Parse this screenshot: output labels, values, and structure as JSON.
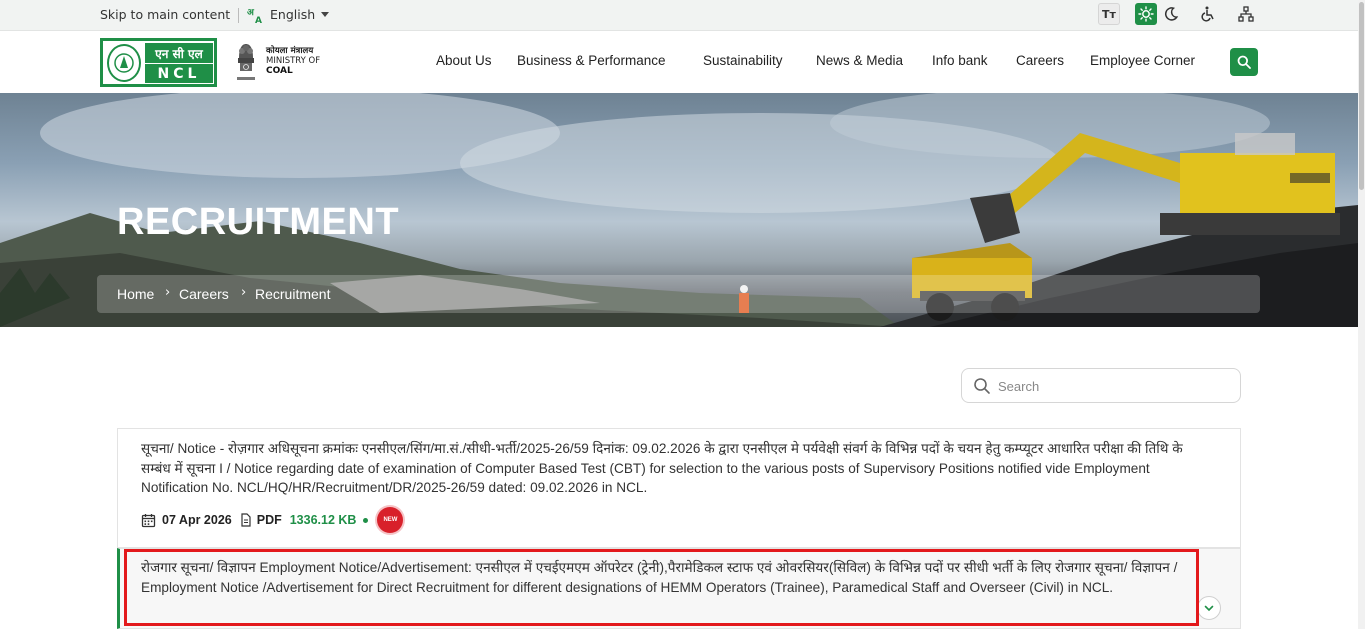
{
  "topbar": {
    "skip_link": "Skip to main content",
    "language": "English",
    "text_size_label": "Tт"
  },
  "header": {
    "logo_hindi": "एन सी एल",
    "logo_english": "NCL",
    "ministry_hindi": "कोयला मंत्रालय",
    "ministry_line1": "MINISTRY OF",
    "ministry_line2": "COAL"
  },
  "nav": {
    "items": [
      {
        "label": "About Us"
      },
      {
        "label": "Business & Performance"
      },
      {
        "label": "Sustainability"
      },
      {
        "label": "News & Media"
      },
      {
        "label": "Info bank"
      },
      {
        "label": "Careers"
      },
      {
        "label": "Employee Corner"
      }
    ]
  },
  "hero": {
    "title": "RECRUITMENT",
    "breadcrumb": [
      {
        "label": "Home"
      },
      {
        "label": "Careers"
      },
      {
        "label": "Recruitment"
      }
    ]
  },
  "search": {
    "placeholder": "Search"
  },
  "notices": [
    {
      "text": "सूचना/ Notice - रोज़गार अधिसूचना क्रमांकः एनसीएल/सिंग/मा.सं./सीधी-भर्ती/2025-26/59 दिनांक: 09.02.2026 के द्वारा एनसीएल मे पर्यवेक्षी संवर्ग के विभिन्न पदों के चयन हेतु कम्प्यूटर आधारित परीक्षा की तिथि के सम्बंध में सूचना I / Notice regarding date of examination of Computer Based Test (CBT) for selection to the various posts of Supervisory Positions notified vide Employment Notification No. NCL/HQ/HR/Recruitment/DR/2025-26/59 dated: 09.02.2026 in NCL.",
      "date": "07 Apr 2026",
      "file_type": "PDF",
      "file_size": "1336.12 KB",
      "badge": "NEW"
    },
    {
      "text": "रोजगार सूचना/ विज्ञापन Employment Notice/Advertisement: एनसीएल में एचईएमएम ऑपरेटर (ट्रेनी),पैरामेडिकल स्टाफ एवं ओवरसियर(सिविल) के विभिन्न पदों पर सीधी भर्ती के लिए रोजगार सूचना/ विज्ञापन / Employment Notice /Advertisement for Direct Recruitment for different designations of HEMM Operators (Trainee), Paramedical Staff and Overseer (Civil) in NCL."
    }
  ],
  "colors": {
    "brand_green": "#1f8f47",
    "highlight_red": "#e3191c",
    "badge_red": "#d8202a"
  }
}
